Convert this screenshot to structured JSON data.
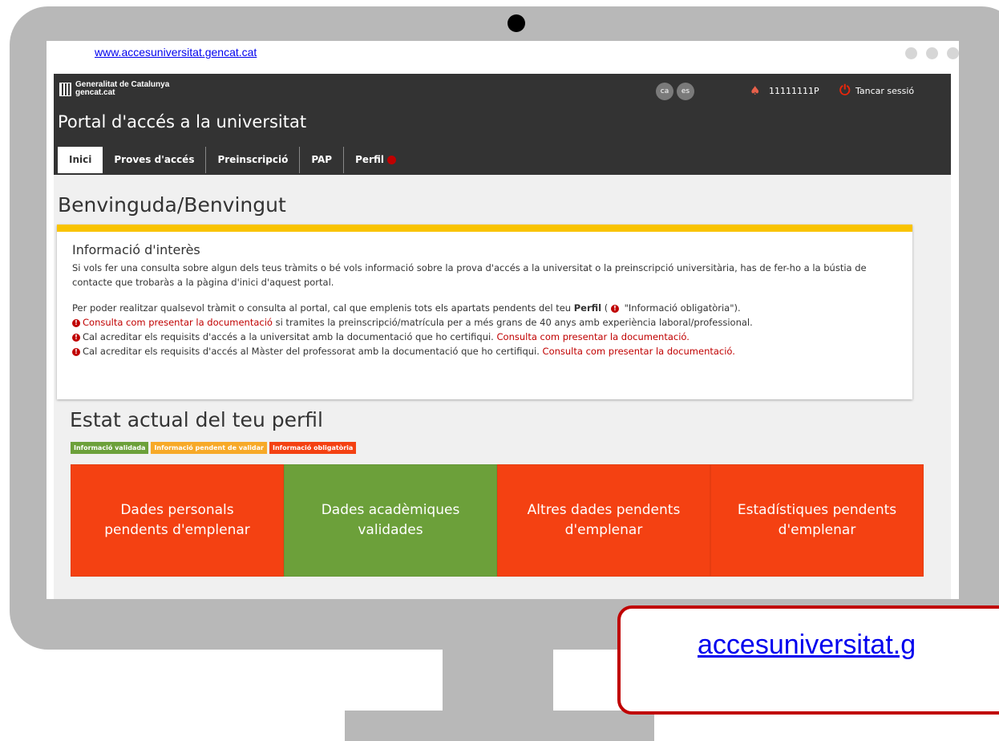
{
  "browser": {
    "url": "www.accesuniversitat.gencat.cat"
  },
  "header": {
    "brand_line1": "Generalitat de Catalunya",
    "brand_line2": "gencat.cat",
    "lang_ca": "ca",
    "lang_es": "es",
    "user_id": "11111111P",
    "logout_label": "Tancar sessió",
    "title": "Portal d'accés a la universitat",
    "user_icon": "user-icon",
    "logout_icon": "power-icon"
  },
  "tabs": [
    {
      "label": "Inici",
      "active": true
    },
    {
      "label": "Proves d'accés"
    },
    {
      "label": "Preinscripció"
    },
    {
      "label": "PAP"
    },
    {
      "label": "Perfil",
      "alert": true
    }
  ],
  "main": {
    "welcome": "Benvinguda/Benvingut",
    "info": {
      "title": "Informació d'interès",
      "p1": "Si vols fer una consulta sobre algun dels teus tràmits o bé vols informació sobre la prova d'accés a la universitat o la preinscripció universitària, has de fer-ho a la bústia de contacte que trobaràs a la pàgina d'inici d'aquest portal.",
      "p2_prefix": "Per poder realitzar qualsevol tràmit o consulta al portal, cal que emplenis tots els apartats pendents del teu ",
      "p2_bold": "Perfil",
      "p2_suffix": " ( ",
      "p2_end": "\"Informació obligatòria\").",
      "b1_link": "Consulta com presentar la documentació",
      "b1_text": " si tramites la preinscripció/matrícula per a més grans de 40 anys amb experiència laboral/professional.",
      "b2_text": "Cal acreditar els requisits d'accés a la universitat amb la documentació que ho certifiqui. ",
      "b2_link": "Consulta com presentar la documentació.",
      "b3_text": "Cal acreditar els requisits d'accés al Màster del professorat amb la documentació que ho certifiqui. ",
      "b3_link": "Consulta com presentar la documentació."
    },
    "status_title": "Estat actual del teu perfil",
    "legend": {
      "validated": "Informació validada",
      "pending": "Informació pendent de validar",
      "mandatory": "Informació obligatòria"
    },
    "cards": [
      {
        "line1": "Dades personals",
        "line2": "pendents d'emplenar"
      },
      {
        "line1": "Dades acadèmiques",
        "line2": "validades"
      },
      {
        "line1": "Altres dades pendents",
        "line2": "d'emplenar"
      },
      {
        "line1": "Estadístiques pendents",
        "line2": "d'emplenar"
      }
    ]
  },
  "footer": {
    "link_text": "accesuniversitat.g"
  },
  "colors": {
    "topbar": "#333333",
    "accent_yellow": "#f9c300",
    "status_red": "#f44112",
    "status_green": "#6ca03a",
    "status_orange": "#f7a928",
    "alert_red": "#c00000"
  }
}
